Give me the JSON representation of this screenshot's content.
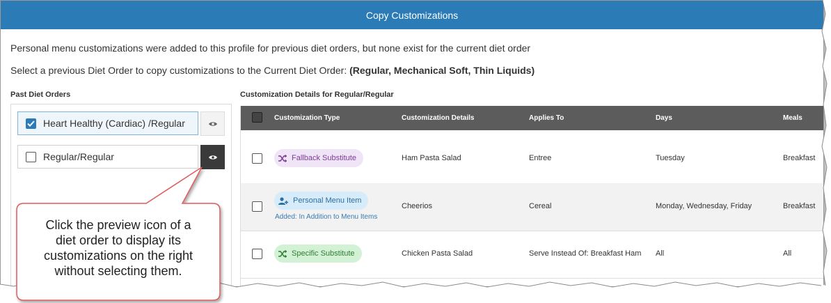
{
  "dialog": {
    "title": "Copy Customizations",
    "info_line": "Personal menu customizations were added to this profile for previous diet orders, but none exist for the current diet order",
    "select_prompt": "Select a previous Diet Order to copy customizations to the Current Diet Order:",
    "current_order": "(Regular, Mechanical Soft, Thin Liquids)"
  },
  "past_orders": {
    "label": "Past Diet Orders",
    "items": [
      {
        "label": "Heart Healthy (Cardiac) /Regular",
        "checked": true
      },
      {
        "label": "Regular/Regular",
        "checked": false
      }
    ],
    "icon": "eye-icon"
  },
  "details": {
    "label": "Customization Details for Regular/Regular",
    "columns": [
      "Customization Type",
      "Customization Details",
      "Applies To",
      "Days",
      "Meals"
    ],
    "rows": [
      {
        "type": "Fallback Substitute",
        "type_icon": "shuffle-icon",
        "type_color": "#f0e4f7",
        "type_text_color": "#7d3c98",
        "note": "",
        "details": "Ham Pasta Salad",
        "applies_to": "Entree",
        "days": "Tuesday",
        "meals": "Breakfast"
      },
      {
        "type": "Personal Menu Item",
        "type_icon": "person-add-icon",
        "type_color": "#d6ecfa",
        "type_text_color": "#2e6e9e",
        "note": "Added: In Addition to Menu Items",
        "details": "Cheerios",
        "applies_to": "Cereal",
        "days": "Monday, Wednesday, Friday",
        "meals": "Breakfast"
      },
      {
        "type": "Specific Substitute",
        "type_icon": "shuffle-icon",
        "type_color": "#d3f2d5",
        "type_text_color": "#2e7d32",
        "note": "",
        "details": "Chicken Pasta Salad",
        "applies_to": "Serve Instead Of: Breakfast Ham",
        "days": "All",
        "meals": "All"
      }
    ]
  },
  "callout": {
    "lines": [
      "Click the preview icon of a",
      "diet order to display its",
      "customizations on the right",
      "without selecting them."
    ]
  },
  "colors": {
    "header_bar": "#2b7bb6",
    "table_header": "#5c5c5c",
    "callout_border": "#e05a5a"
  }
}
